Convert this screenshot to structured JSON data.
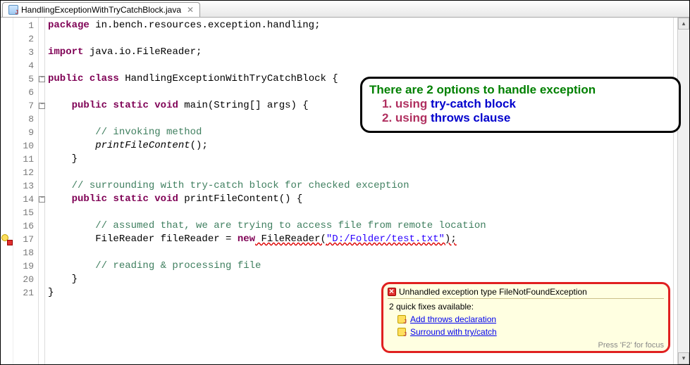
{
  "tab": {
    "filename": "HandlingExceptionWithTryCatchBlock.java",
    "close_glyph": "✕"
  },
  "lines": [
    "1",
    "2",
    "3",
    "4",
    "5",
    "6",
    "7",
    "8",
    "9",
    "10",
    "11",
    "12",
    "13",
    "14",
    "15",
    "16",
    "17",
    "18",
    "19",
    "20",
    "21"
  ],
  "code": {
    "l1_kw1": "package",
    "l1_rest": " in.bench.resources.exception.handling;",
    "l3_kw1": "import",
    "l3_rest": " java.io.FileReader;",
    "l5_kw1": "public",
    "l5_kw2": "class",
    "l5_name": " HandlingExceptionWithTryCatchBlock {",
    "l7_pre": "    ",
    "l7_kw1": "public",
    "l7_kw2": "static",
    "l7_kw3": "void",
    "l7_sig": " main(String[] args) {",
    "l9_pre": "        ",
    "l9_cm": "// invoking method",
    "l10_pre": "        ",
    "l10_call": "printFileContent",
    "l10_rest": "();",
    "l11_pre": "    }",
    "l13_pre": "    ",
    "l13_cm": "// surrounding with try-catch block for checked exception",
    "l14_pre": "    ",
    "l14_kw1": "public",
    "l14_kw2": "static",
    "l14_kw3": "void",
    "l14_sig": " printFileContent() {",
    "l16_pre": "        ",
    "l16_cm": "// assumed that, we are trying to access file from remote location",
    "l17_pre": "        FileReader fileReader = ",
    "l17_kw": "new",
    "l17_ctor": " FileReader(",
    "l17_str": "\"D:/Folder/test.txt\"",
    "l17_end": ");",
    "l19_pre": "        ",
    "l19_cm": "// reading & processing file",
    "l20_pre": "    }",
    "l21_pre": "}"
  },
  "callout": {
    "head": "There are 2 options to handle exception",
    "opt1_num": "1. using ",
    "opt1_key": "try-catch block",
    "opt2_num": "2. using ",
    "opt2_key": "throws clause"
  },
  "tooltip": {
    "title": "Unhandled exception type FileNotFoundException",
    "fixes_head": "2 quick fixes available:",
    "fix1": "Add throws declaration",
    "fix2": "Surround with try/catch",
    "footer": "Press 'F2' for focus"
  },
  "scroll": {
    "up": "▴",
    "down": "▾"
  }
}
